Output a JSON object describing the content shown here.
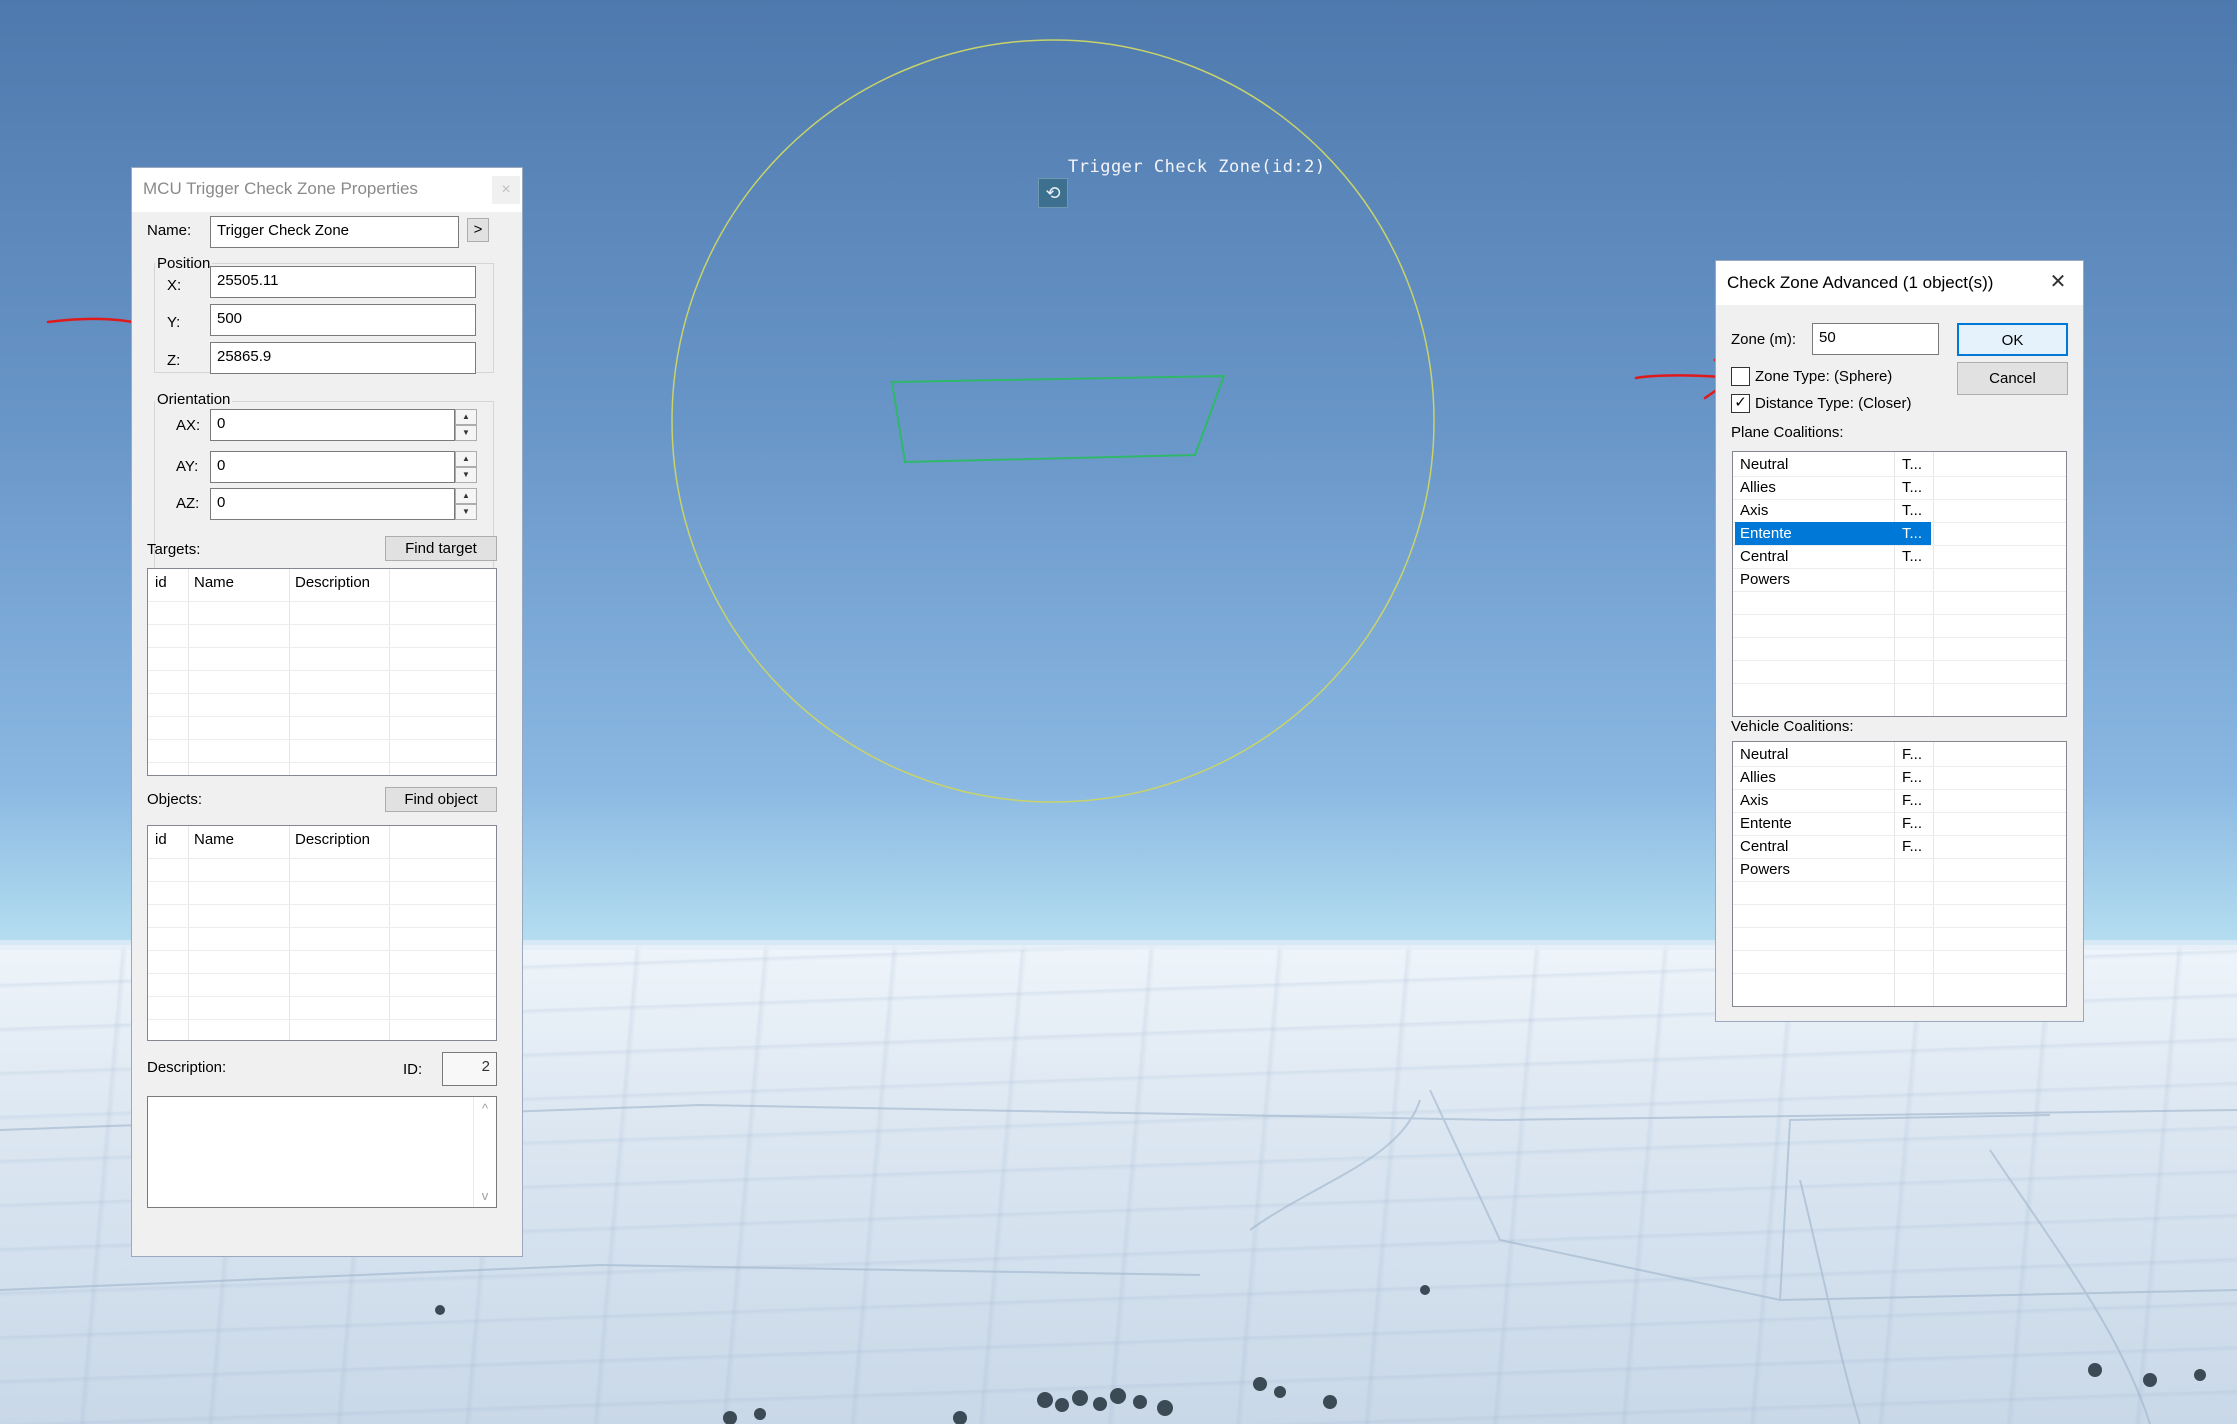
{
  "scene": {
    "zone_label": "Trigger Check Zone(id:2)",
    "circle_color": "#c8d36a",
    "trapezoid_color": "#2fb86a"
  },
  "props_window": {
    "title": "MCU Trigger Check Zone Properties",
    "close_glyph": "×",
    "name_label": "Name:",
    "name_value": "Trigger Check Zone",
    "name_button": ">",
    "position_label": "Position",
    "x_label": "X:",
    "x_value": "25505.11",
    "y_label": "Y:",
    "y_value": "500",
    "z_label": "Z:",
    "z_value": "25865.9",
    "orientation_label": "Orientation",
    "ax_label": "AX:",
    "ax_value": "0",
    "ay_label": "AY:",
    "ay_value": "0",
    "az_label": "AZ:",
    "az_value": "0",
    "spin_up": "▲",
    "spin_down": "▼",
    "targets_label": "Targets:",
    "find_target": "Find target",
    "objects_label": "Objects:",
    "find_object": "Find object",
    "columns": [
      "id",
      "Name",
      "Description"
    ],
    "description_label": "Description:",
    "id_label": "ID:",
    "id_value": "2",
    "scroll_up": "^",
    "scroll_down": "v"
  },
  "advanced_window": {
    "title": "Check Zone Advanced (1 object(s))",
    "close_glyph": "✕",
    "zone_label": "Zone (m):",
    "zone_value": "50",
    "ok": "OK",
    "cancel": "Cancel",
    "zone_type_label": "Zone Type: (Sphere)",
    "zone_type_checked": false,
    "distance_type_label": "Distance Type: (Closer)",
    "distance_type_checked": true,
    "check_mark": "✓",
    "plane_label": "Plane Coalitions:",
    "plane_rows": [
      {
        "name": "Neutral",
        "value": "T..."
      },
      {
        "name": "Allies",
        "value": "T..."
      },
      {
        "name": "Axis",
        "value": "T..."
      },
      {
        "name": "Entente",
        "value": "T..."
      },
      {
        "name": "Central Powers",
        "value": "T..."
      }
    ],
    "plane_selected": "Entente",
    "vehicle_label": "Vehicle Coalitions:",
    "vehicle_rows": [
      {
        "name": "Neutral",
        "value": "F..."
      },
      {
        "name": "Allies",
        "value": "F..."
      },
      {
        "name": "Axis",
        "value": "F..."
      },
      {
        "name": "Entente",
        "value": "F..."
      },
      {
        "name": "Central Powers",
        "value": "F..."
      }
    ]
  },
  "annotation_color": "#e0191b"
}
